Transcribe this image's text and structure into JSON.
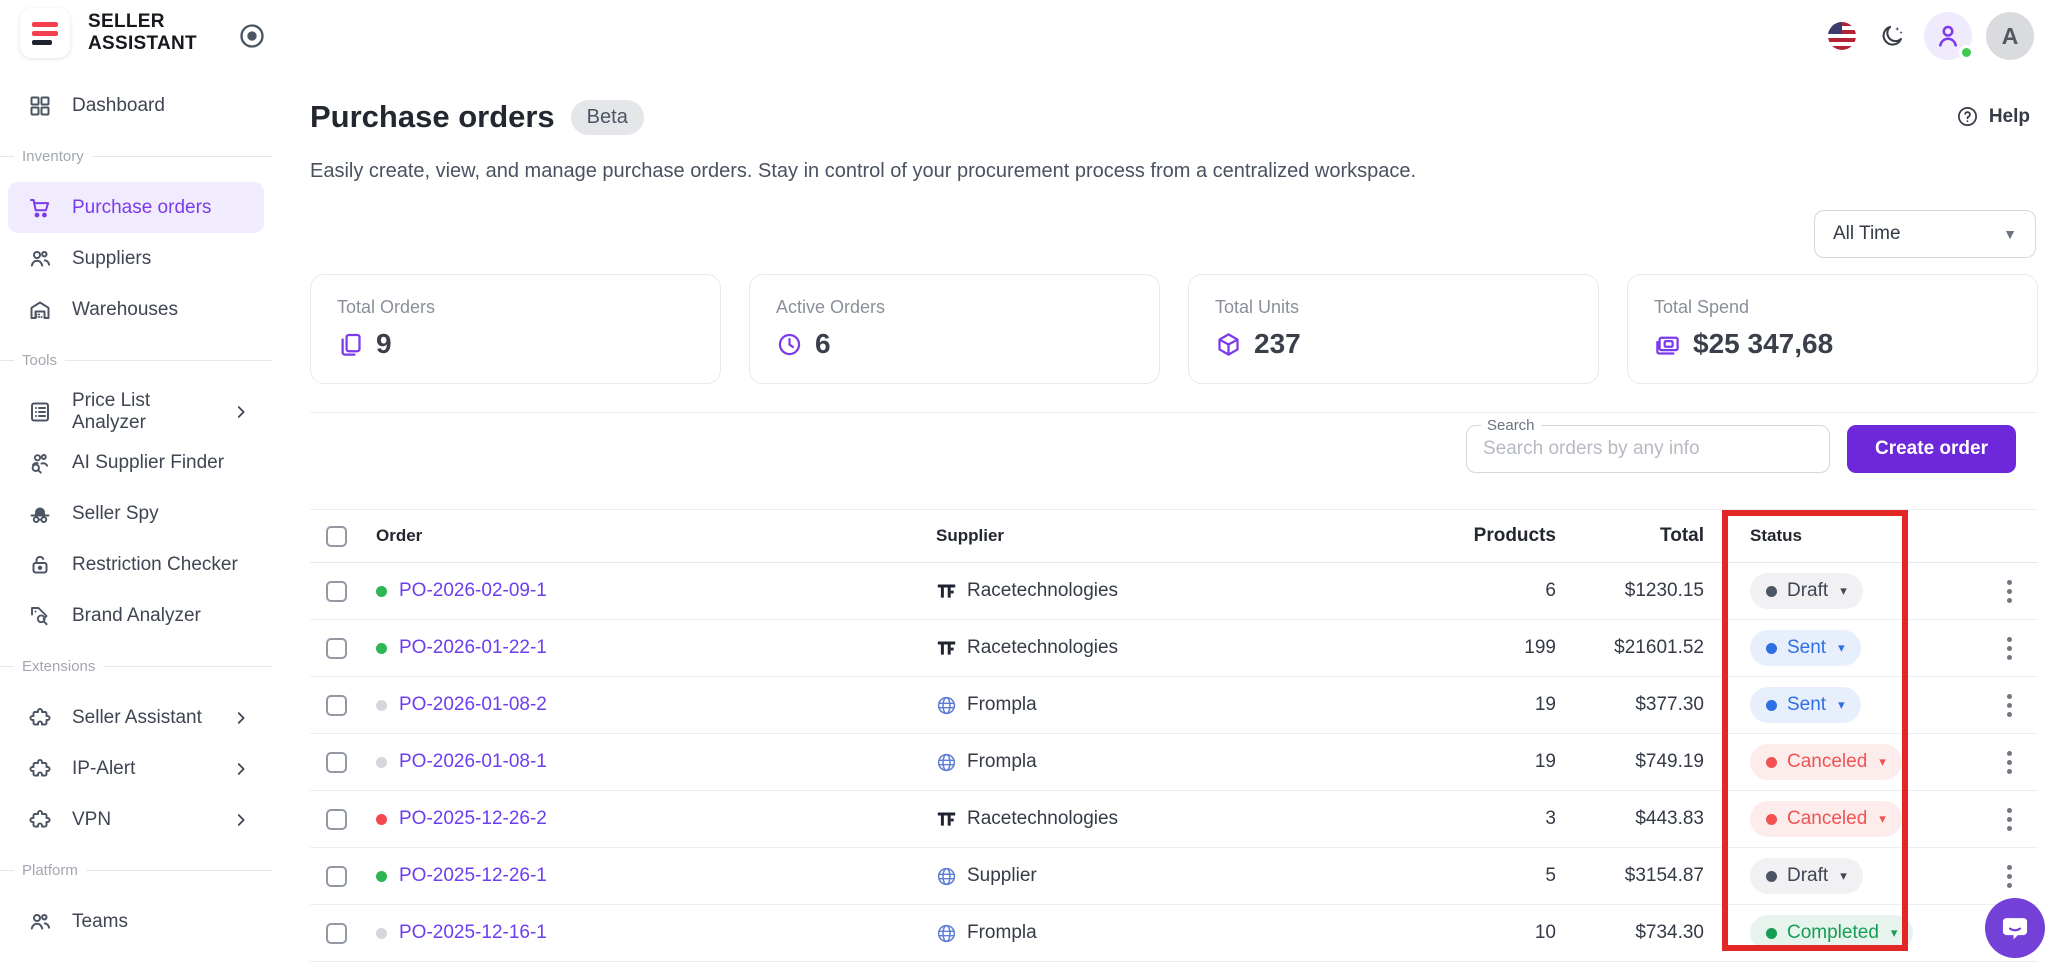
{
  "brand": {
    "line1": "SELLER",
    "line2": "ASSISTANT"
  },
  "colors": {
    "accent_purple": "#6d28d9",
    "link_purple": "#6d3df0",
    "annotation_red": "#e32726",
    "status_draft": "#4b5563",
    "status_sent": "#2f6fe4",
    "status_canceled": "#f25252",
    "status_completed": "#169d55"
  },
  "sidebar": {
    "items": [
      {
        "type": "item",
        "label": "Dashboard",
        "icon": "dashboard-icon"
      },
      {
        "type": "section",
        "label": "Inventory"
      },
      {
        "type": "item",
        "label": "Purchase orders",
        "icon": "cart-icon",
        "active": true
      },
      {
        "type": "item",
        "label": "Suppliers",
        "icon": "suppliers-icon"
      },
      {
        "type": "item",
        "label": "Warehouses",
        "icon": "warehouse-icon"
      },
      {
        "type": "section",
        "label": "Tools"
      },
      {
        "type": "item",
        "label": "Price List Analyzer",
        "icon": "price-list-icon",
        "chevron": true
      },
      {
        "type": "item",
        "label": "AI Supplier Finder",
        "icon": "ai-supplier-finder-icon"
      },
      {
        "type": "item",
        "label": "Seller Spy",
        "icon": "spy-icon"
      },
      {
        "type": "item",
        "label": "Restriction Checker",
        "icon": "lock-icon"
      },
      {
        "type": "item",
        "label": "Brand Analyzer",
        "icon": "brand-analyzer-icon"
      },
      {
        "type": "section",
        "label": "Extensions"
      },
      {
        "type": "item",
        "label": "Seller Assistant",
        "icon": "puzzle-icon",
        "chevron": true
      },
      {
        "type": "item",
        "label": "IP-Alert",
        "icon": "puzzle-icon",
        "chevron": true
      },
      {
        "type": "item",
        "label": "VPN",
        "icon": "puzzle-icon",
        "chevron": true
      },
      {
        "type": "section",
        "label": "Platform"
      },
      {
        "type": "item",
        "label": "Teams",
        "icon": "teams-icon"
      }
    ]
  },
  "header": {
    "title": "Purchase orders",
    "badge": "Beta",
    "subtitle": "Easily create, view, and manage purchase orders. Stay in control of your procurement process from a centralized workspace.",
    "help_label": "Help"
  },
  "filters": {
    "time_range": "All Time"
  },
  "stats": [
    {
      "label": "Total Orders",
      "value": "9",
      "icon": "orders-copy-icon"
    },
    {
      "label": "Active Orders",
      "value": "6",
      "icon": "clock-icon"
    },
    {
      "label": "Total Units",
      "value": "237",
      "icon": "cube-icon"
    },
    {
      "label": "Total Spend",
      "value": "$25 347,68",
      "icon": "banknote-icon"
    }
  ],
  "toolbar": {
    "search_label": "Search",
    "search_placeholder": "Search orders by any info",
    "create_button": "Create order"
  },
  "table": {
    "columns": {
      "order": "Order",
      "supplier": "Supplier",
      "products": "Products",
      "total": "Total",
      "status": "Status"
    },
    "rows": [
      {
        "dot": "green",
        "order": "PO-2026-02-09-1",
        "supplier": "Racetechnologies",
        "logo": "racetech",
        "products": "6",
        "total": "$1230.15",
        "status": "Draft",
        "variant": "draft"
      },
      {
        "dot": "green",
        "order": "PO-2026-01-22-1",
        "supplier": "Racetechnologies",
        "logo": "racetech",
        "products": "199",
        "total": "$21601.52",
        "status": "Sent",
        "variant": "sent"
      },
      {
        "dot": "gray",
        "order": "PO-2026-01-08-2",
        "supplier": "Frompla",
        "logo": "globe",
        "products": "19",
        "total": "$377.30",
        "status": "Sent",
        "variant": "sent"
      },
      {
        "dot": "gray",
        "order": "PO-2026-01-08-1",
        "supplier": "Frompla",
        "logo": "globe",
        "products": "19",
        "total": "$749.19",
        "status": "Canceled",
        "variant": "canceled"
      },
      {
        "dot": "red",
        "order": "PO-2025-12-26-2",
        "supplier": "Racetechnologies",
        "logo": "racetech",
        "products": "3",
        "total": "$443.83",
        "status": "Canceled",
        "variant": "canceled"
      },
      {
        "dot": "green",
        "order": "PO-2025-12-26-1",
        "supplier": "Supplier",
        "logo": "globe",
        "products": "5",
        "total": "$3154.87",
        "status": "Draft",
        "variant": "draft"
      },
      {
        "dot": "gray",
        "order": "PO-2025-12-16-1",
        "supplier": "Frompla",
        "logo": "globe",
        "products": "10",
        "total": "$734.30",
        "status": "Completed",
        "variant": "completed"
      }
    ]
  },
  "annotation": {
    "type": "highlight-box",
    "target": "status-column",
    "color": "#e32726"
  },
  "profile": {
    "avatar_initial": "A"
  }
}
